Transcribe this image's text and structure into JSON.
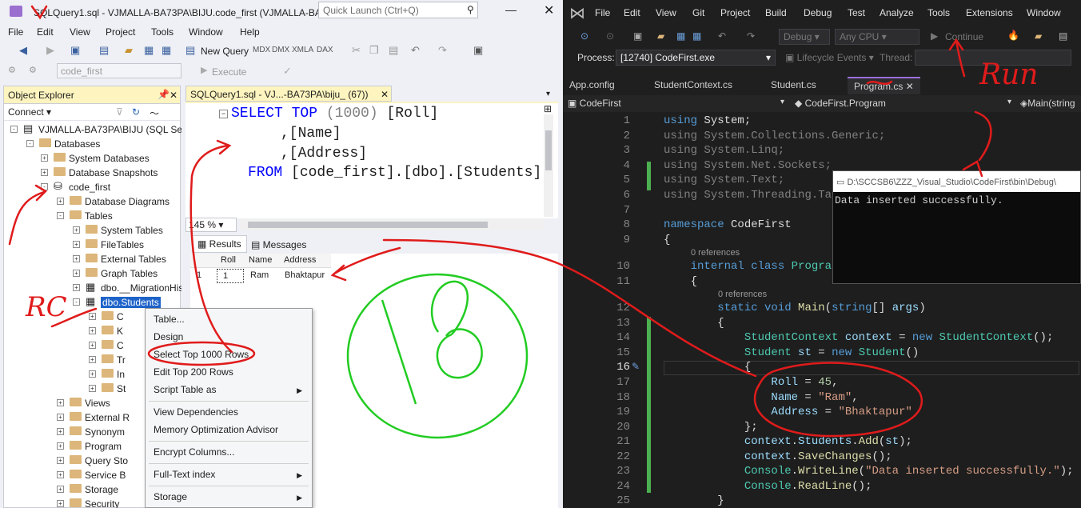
{
  "ssms": {
    "window_title": "SQLQuery1.sql - VJMALLA-BA73PA\\BIJU.code_first (VJMALLA-BA...",
    "quick_launch_placeholder": "Quick Launch (Ctrl+Q)",
    "menu": [
      "File",
      "Edit",
      "View",
      "Project",
      "Tools",
      "Window",
      "Help"
    ],
    "new_query_label": "New Query",
    "execute_label": "Execute",
    "database_combo": "code_first",
    "object_explorer": {
      "title": "Object Explorer",
      "connect_label": "Connect",
      "tree": [
        {
          "label": "VJMALLA-BA73PA\\BIJU (SQL Serv",
          "exp": "-",
          "icon": "server"
        },
        {
          "label": "Databases",
          "exp": "-",
          "icon": "folder"
        },
        {
          "label": "System Databases",
          "exp": "+",
          "icon": "folder"
        },
        {
          "label": "Database Snapshots",
          "exp": "+",
          "icon": "folder"
        },
        {
          "label": "code_first",
          "exp": "-",
          "icon": "database"
        },
        {
          "label": "Database Diagrams",
          "exp": "+",
          "icon": "folder"
        },
        {
          "label": "Tables",
          "exp": "-",
          "icon": "folder"
        },
        {
          "label": "System Tables",
          "exp": "+",
          "icon": "folder"
        },
        {
          "label": "FileTables",
          "exp": "+",
          "icon": "folder"
        },
        {
          "label": "External Tables",
          "exp": "+",
          "icon": "folder"
        },
        {
          "label": "Graph Tables",
          "exp": "+",
          "icon": "folder"
        },
        {
          "label": "dbo.__MigrationHis",
          "exp": "+",
          "icon": "table"
        },
        {
          "label": "dbo.Students",
          "exp": "-",
          "icon": "table"
        },
        {
          "label": "C",
          "exp": "+",
          "icon": "folder"
        },
        {
          "label": "K",
          "exp": "+",
          "icon": "folder"
        },
        {
          "label": "C",
          "exp": "+",
          "icon": "folder"
        },
        {
          "label": "Tr",
          "exp": "+",
          "icon": "folder"
        },
        {
          "label": "In",
          "exp": "+",
          "icon": "folder"
        },
        {
          "label": "St",
          "exp": "+",
          "icon": "folder"
        },
        {
          "label": "Views",
          "exp": "+",
          "icon": "folder"
        },
        {
          "label": "External R",
          "exp": "+",
          "icon": "folder"
        },
        {
          "label": "Synonym",
          "exp": "+",
          "icon": "folder"
        },
        {
          "label": "Program",
          "exp": "+",
          "icon": "folder"
        },
        {
          "label": "Query Sto",
          "exp": "+",
          "icon": "folder"
        },
        {
          "label": "Service B",
          "exp": "+",
          "icon": "folder"
        },
        {
          "label": "Storage",
          "exp": "+",
          "icon": "folder"
        },
        {
          "label": "Security",
          "exp": "+",
          "icon": "folder"
        }
      ]
    },
    "query_tab": "SQLQuery1.sql - VJ...-BA73PA\\biju_ (67))",
    "sql": {
      "l1a": "SELECT TOP",
      "l1b": "(1000)",
      "l1c": "[Roll]",
      "l2": ",[Name]",
      "l3": ",[Address]",
      "l4a": "FROM",
      "l4b": "[code_first].[dbo].[Students]"
    },
    "zoom": "145 %",
    "results_tab": "Results",
    "messages_tab": "Messages",
    "grid": {
      "columns": [
        "Roll",
        "Name",
        "Address"
      ],
      "rows": [
        {
          "num": "1",
          "values": [
            "1",
            "Ram",
            "Bhaktapur"
          ]
        }
      ]
    },
    "context_menu": [
      "Table...",
      "Design",
      "Select Top 1000 Rows",
      "Edit Top 200 Rows",
      "Script Table as",
      "View Dependencies",
      "Memory Optimization Advisor",
      "Encrypt Columns...",
      "Full-Text index",
      "Storage"
    ]
  },
  "vs": {
    "menu": [
      "File",
      "Edit",
      "View",
      "Git",
      "Project",
      "Build",
      "Debug",
      "Test",
      "Analyze",
      "Tools",
      "Extensions",
      "Window"
    ],
    "config_combo": "Debug",
    "platform_combo": "Any CPU",
    "continue_label": "Continue",
    "process_label": "Process:",
    "process_value": "[12740] CodeFirst.exe",
    "lifecycle_label": "Lifecycle Events",
    "thread_label": "Thread:",
    "tabs": [
      "App.config",
      "StudentContext.cs",
      "Student.cs",
      "Program.cs"
    ],
    "nav_project": "CodeFirst",
    "nav_class": "CodeFirst.Program",
    "nav_member": "Main(string",
    "references_text": "0 references",
    "console_title": "D:\\SCCSB6\\ZZZ_Visual_Studio\\CodeFirst\\bin\\Debug\\",
    "console_output": "Data inserted successfully.",
    "line_numbers": [
      "1",
      "2",
      "3",
      "4",
      "5",
      "6",
      "7",
      "8",
      "9",
      "10",
      "11",
      "12",
      "13",
      "14",
      "15",
      "16",
      "17",
      "18",
      "19",
      "20",
      "21",
      "22",
      "23",
      "24",
      "25"
    ]
  },
  "annotations": {
    "run": "Run",
    "rc": "RC",
    "count": "18"
  },
  "colors": {
    "ssms_bg": "#eef0f5",
    "vs_bg": "#1e1e1e",
    "annotation_red": "#e01b1b",
    "annotation_green": "#22cc22"
  }
}
